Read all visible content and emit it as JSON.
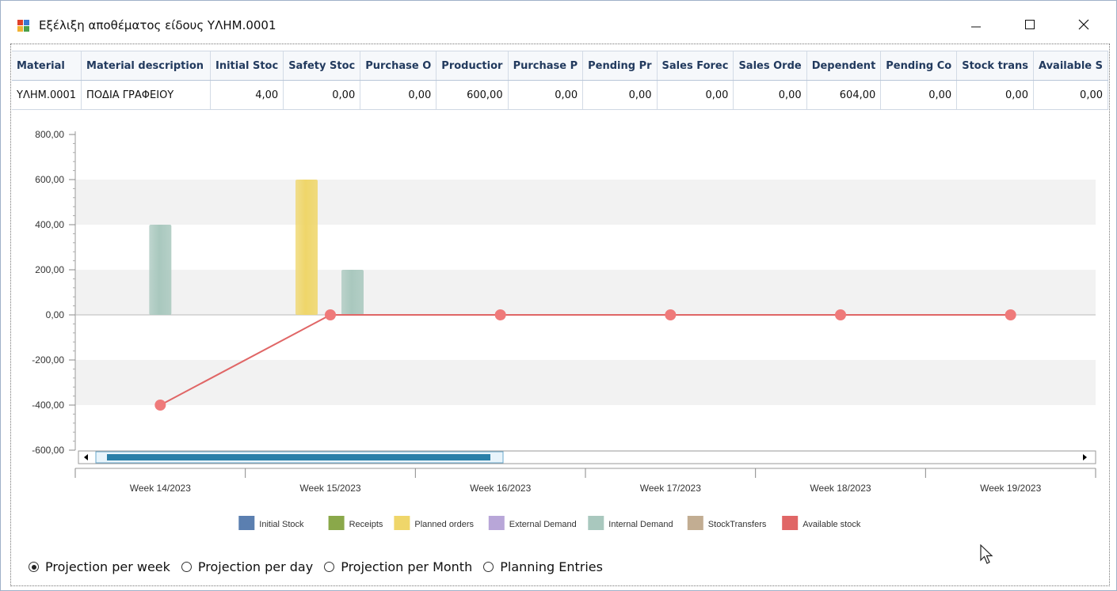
{
  "window": {
    "title": "Εξέλιξη αποθέματος είδους ΥΛΗΜ.0001",
    "minimize_glyph": "—",
    "maximize_glyph": "☐",
    "close_glyph": "✕"
  },
  "grid": {
    "columns": [
      {
        "label": "Material",
        "width": 84
      },
      {
        "label": "Material description",
        "width": 184
      },
      {
        "label": "Initial Stoc",
        "width": 92
      },
      {
        "label": "Safety Stoc",
        "width": 94
      },
      {
        "label": "Purchase O",
        "width": 94
      },
      {
        "label": "Productior",
        "width": 92
      },
      {
        "label": "Purchase P",
        "width": 94
      },
      {
        "label": "Pending Pr",
        "width": 92
      },
      {
        "label": "Sales Forec",
        "width": 94
      },
      {
        "label": "Sales Orde",
        "width": 92
      },
      {
        "label": "Dependent",
        "width": 92
      },
      {
        "label": "Pending Co",
        "width": 94
      },
      {
        "label": "Stock trans",
        "width": 92
      },
      {
        "label": "Available S",
        "width": 92
      }
    ],
    "rows": [
      [
        "ΥΛΗΜ.0001",
        "ΠΟΔΙΑ ΓΡΑΦΕΙΟΥ",
        "4,00",
        "0,00",
        "0,00",
        "600,00",
        "0,00",
        "0,00",
        "0,00",
        "0,00",
        "604,00",
        "0,00",
        "0,00",
        "0,00"
      ]
    ]
  },
  "chart_data": {
    "type": "bar",
    "categories": [
      "Week 14/2023",
      "Week 15/2023",
      "Week 16/2023",
      "Week 17/2023",
      "Week 18/2023",
      "Week 19/2023"
    ],
    "ylim": [
      -600,
      800
    ],
    "yticks": [
      "800,00",
      "600,00",
      "400,00",
      "200,00",
      "0,00",
      "-200,00",
      "-400,00",
      "-600,00"
    ],
    "ytick_values": [
      800,
      600,
      400,
      200,
      0,
      -200,
      -400,
      -600
    ],
    "series": [
      {
        "name": "Initial Stock",
        "type": "bar",
        "color": "#5b7fb0",
        "values": [
          0,
          0,
          0,
          0,
          0,
          0
        ]
      },
      {
        "name": "Receipts",
        "type": "bar",
        "color": "#8aa84a",
        "values": [
          0,
          0,
          0,
          0,
          0,
          0
        ]
      },
      {
        "name": "Planned orders",
        "type": "bar",
        "color": "#efd66a",
        "values": [
          0,
          600,
          0,
          0,
          0,
          0
        ]
      },
      {
        "name": "External Demand",
        "type": "bar",
        "color": "#b8a6d8",
        "values": [
          0,
          0,
          0,
          0,
          0,
          0
        ]
      },
      {
        "name": "Internal Demand",
        "type": "bar",
        "color": "#a9c8be",
        "values": [
          400,
          200,
          0,
          0,
          0,
          0
        ]
      },
      {
        "name": "StockTransfers",
        "type": "bar",
        "color": "#c2ad92",
        "values": [
          0,
          0,
          0,
          0,
          0,
          0
        ]
      },
      {
        "name": "Available stock",
        "type": "line",
        "color": "#e06666",
        "values": [
          -400,
          0,
          0,
          0,
          0,
          0
        ]
      }
    ],
    "grid": true
  },
  "view_options": [
    {
      "label": "Projection per week",
      "checked": true
    },
    {
      "label": "Projection per day",
      "checked": false
    },
    {
      "label": "Projection per Month",
      "checked": false
    },
    {
      "label": "Planning Entries",
      "checked": false
    }
  ],
  "colors": {
    "header_text": "#223a5e",
    "scrollbar_thumb": "#2a7fa8",
    "band": "#f2f2f2"
  }
}
